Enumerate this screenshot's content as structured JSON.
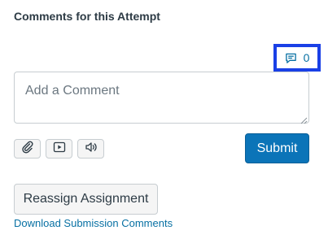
{
  "section": {
    "title": "Comments for this Attempt"
  },
  "comment_counter": {
    "icon": "comment-icon",
    "count": "0"
  },
  "comment_input": {
    "value": "",
    "placeholder": "Add a Comment"
  },
  "media_buttons": {
    "attach_icon": "paperclip-icon",
    "video_icon": "video-icon",
    "audio_icon": "speaker-icon"
  },
  "actions": {
    "submit_label": "Submit",
    "reassign_label": "Reassign Assignment",
    "download_label": "Download Submission Comments"
  },
  "colors": {
    "primary": "#0b74b8",
    "link": "#0770a3",
    "highlight_border": "#1a40e6"
  }
}
